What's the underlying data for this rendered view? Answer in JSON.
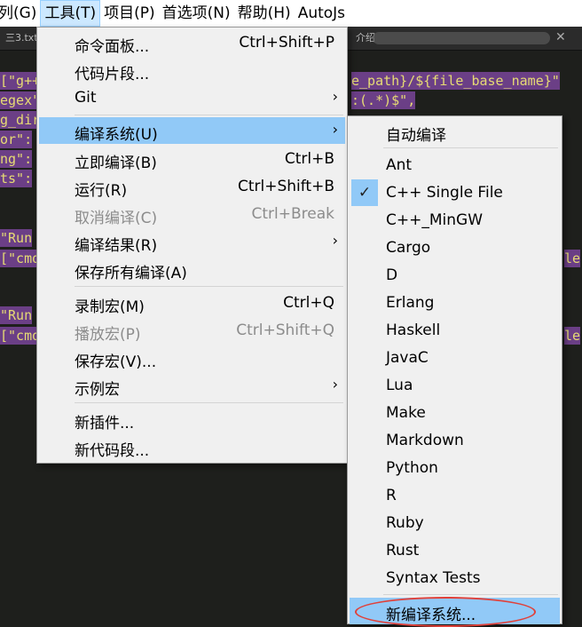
{
  "menubar": {
    "items": [
      "列(G)",
      "工具(T)",
      "项目(P)",
      "首选项(N)",
      "帮助(H)",
      "AutoJs"
    ]
  },
  "tabs": [
    "三3.txt",
    "介绍"
  ],
  "code_lines": [
    {
      "left": "[\"g++",
      "right": "e_path}/${file_base_name}\""
    },
    {
      "left": "egex\"",
      "right": ":(.*)$\","
    },
    {
      "left": "g_dir",
      "right": ""
    },
    {
      "left": "or\":",
      "right": ""
    },
    {
      "left": "ng\":",
      "right": ""
    },
    {
      "left": "ts\":",
      "right": ""
    },
    {
      "left": "\"Run",
      "right": ""
    },
    {
      "left": "[\"cmd",
      "right": "le"
    },
    {
      "left": "\"Run",
      "right": ""
    },
    {
      "left": "[\"cmd",
      "right": "le"
    }
  ],
  "tools_menu": {
    "items": [
      {
        "label": "命令面板...",
        "shortcut": "Ctrl+Shift+P"
      },
      {
        "label": "代码片段...",
        "shortcut": ""
      },
      {
        "label": "Git",
        "shortcut": "›"
      },
      {
        "label": "编译系统(U)",
        "shortcut": "›"
      },
      {
        "label": "立即编译(B)",
        "shortcut": "Ctrl+B"
      },
      {
        "label": "运行(R)",
        "shortcut": "Ctrl+Shift+B"
      },
      {
        "label": "取消编译(C)",
        "shortcut": "Ctrl+Break"
      },
      {
        "label": "编译结果(R)",
        "shortcut": "›"
      },
      {
        "label": "保存所有编译(A)",
        "shortcut": ""
      },
      {
        "label": "录制宏(M)",
        "shortcut": "Ctrl+Q"
      },
      {
        "label": "播放宏(P)",
        "shortcut": "Ctrl+Shift+Q"
      },
      {
        "label": "保存宏(V)...",
        "shortcut": ""
      },
      {
        "label": "示例宏",
        "shortcut": "›"
      },
      {
        "label": "新插件...",
        "shortcut": ""
      },
      {
        "label": "新代码段...",
        "shortcut": ""
      }
    ]
  },
  "build_menu": {
    "items": [
      "自动编译",
      "Ant",
      "C++ Single File",
      "C++_MinGW",
      "Cargo",
      "D",
      "Erlang",
      "Haskell",
      "JavaC",
      "Lua",
      "Make",
      "Markdown",
      "Python",
      "R",
      "Ruby",
      "Rust",
      "Syntax Tests",
      "新编译系统..."
    ],
    "checked": "✓"
  },
  "colors": {
    "highlight": "#91c9f7",
    "annotation": "#e0413a"
  }
}
